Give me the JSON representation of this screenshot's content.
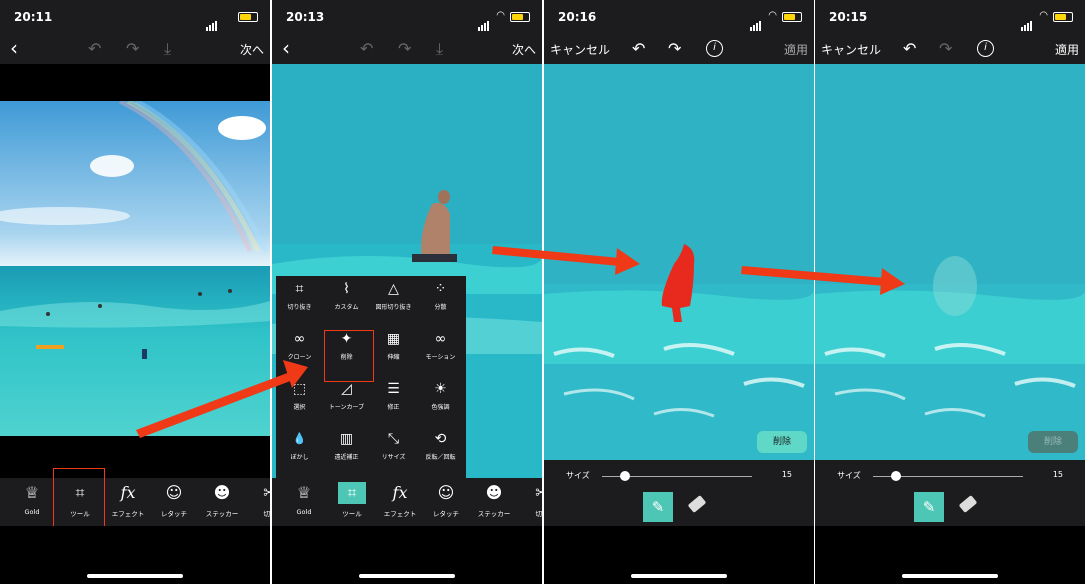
{
  "panels": [
    {
      "time": "20:11",
      "back": "‹",
      "undo": "↶",
      "redo": "↷",
      "download": "⤓",
      "next": "次へ"
    },
    {
      "time": "20:13",
      "back": "‹",
      "undo": "↶",
      "redo": "↷",
      "download": "⤓",
      "next": "次へ"
    },
    {
      "time": "20:16",
      "cancel": "キャンセル",
      "undo": "↶",
      "redo": "↷",
      "info": "i",
      "apply": "適用",
      "delete": "削除",
      "size_label": "サイズ",
      "size_value": "15"
    },
    {
      "time": "20:15",
      "cancel": "キャンセル",
      "undo": "↶",
      "redo": "↷",
      "info": "i",
      "apply": "適用",
      "delete": "削除",
      "size_label": "サイズ",
      "size_value": "15"
    }
  ],
  "toolbar": [
    {
      "label": "Gold",
      "icon": "crown-icon",
      "glyph": "♕"
    },
    {
      "label": "ツール",
      "icon": "crop-icon",
      "glyph": "⌗"
    },
    {
      "label": "エフェクト",
      "icon": "fx-icon",
      "glyph": "fx"
    },
    {
      "label": "レタッチ",
      "icon": "retouch-icon",
      "glyph": "☺"
    },
    {
      "label": "ステッカー",
      "icon": "sticker-icon",
      "glyph": "☻"
    },
    {
      "label": "切り",
      "icon": "cutout-icon",
      "glyph": "✂"
    }
  ],
  "tool_menu": [
    {
      "label": "切り抜き",
      "glyph": "⌗"
    },
    {
      "label": "カスタム",
      "glyph": "⌇"
    },
    {
      "label": "図形切り抜き",
      "glyph": "△"
    },
    {
      "label": "分散",
      "glyph": "⁘"
    },
    {
      "label": "クローン",
      "glyph": "∞"
    },
    {
      "label": "削除",
      "glyph": "✦"
    },
    {
      "label": "伸縮",
      "glyph": "▦"
    },
    {
      "label": "モーション",
      "glyph": "∞"
    },
    {
      "label": "選択",
      "glyph": "⬚"
    },
    {
      "label": "トーンカーブ",
      "glyph": "◿"
    },
    {
      "label": "修正",
      "glyph": "☰"
    },
    {
      "label": "色強調",
      "glyph": "☀"
    },
    {
      "label": "ぼかし",
      "glyph": "💧"
    },
    {
      "label": "遠近補正",
      "glyph": "▥"
    },
    {
      "label": "リサイズ",
      "glyph": "⤡"
    },
    {
      "label": "反転／回転",
      "glyph": "⟲"
    }
  ],
  "colors": {
    "accent": "#4dc6b6",
    "highlight": "#f03a17",
    "arrow": "#f03a17",
    "bar": "#1c1c1e"
  }
}
